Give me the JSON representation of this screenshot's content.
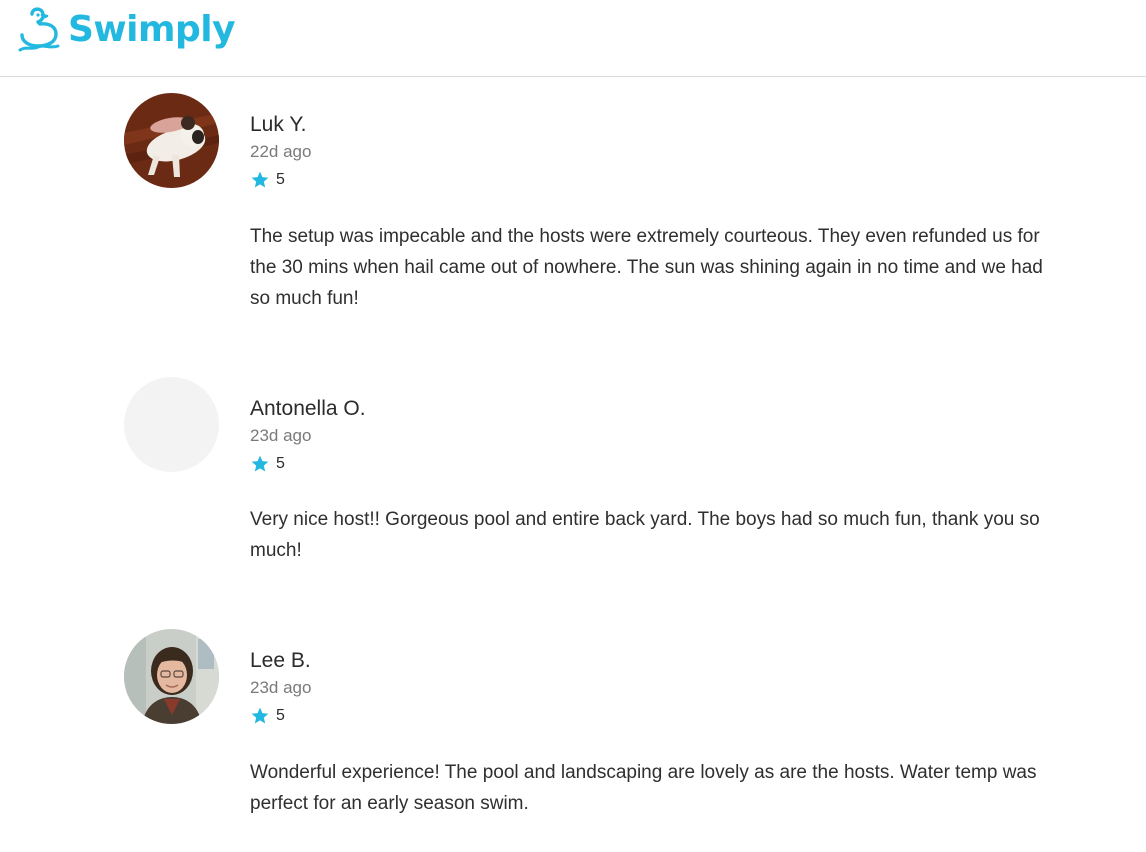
{
  "brand": {
    "name": "Swimply",
    "color": "#22b8e0"
  },
  "star_color": "#22b8e0",
  "reviews": [
    {
      "name": "Luk Y.",
      "date": "22d ago",
      "rating": "5",
      "text": "The setup was impecable and the hosts were extremely courteous. They even refunded us for the 30 mins when hail came out of nowhere. The sun was shining again in no time and we had so much fun!",
      "avatar": "photo"
    },
    {
      "name": "Antonella O.",
      "date": "23d ago",
      "rating": "5",
      "text": "Very nice host!! Gorgeous pool and entire back yard. The boys had so much fun, thank you so much!",
      "avatar": "placeholder"
    },
    {
      "name": "Lee B.",
      "date": "23d ago",
      "rating": "5",
      "text": "Wonderful experience! The pool and landscaping are lovely as are the hosts. Water temp was perfect for an early season swim.",
      "avatar": "photo"
    }
  ]
}
